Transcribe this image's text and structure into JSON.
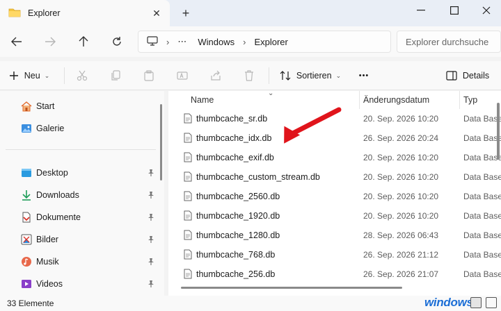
{
  "window": {
    "tab_title": "Explorer",
    "tab_icon": "folder-icon",
    "minimize_icon": "minimize-icon",
    "maximize_icon": "maximize-icon",
    "close_icon": "close-icon"
  },
  "address": {
    "breadcrumb": [
      "Windows",
      "Explorer"
    ],
    "search_placeholder": "Explorer durchsuchen"
  },
  "toolbar": {
    "new_label": "Neu",
    "sort_label": "Sortieren",
    "more_label": "•••",
    "details_label": "Details"
  },
  "sidebar": {
    "items": [
      {
        "label": "Start",
        "icon": "home-icon"
      },
      {
        "label": "Galerie",
        "icon": "gallery-icon"
      },
      {
        "label": "Desktop",
        "icon": "desktop-icon",
        "pinned": true
      },
      {
        "label": "Downloads",
        "icon": "download-icon",
        "pinned": true
      },
      {
        "label": "Dokumente",
        "icon": "documents-icon",
        "pinned": true
      },
      {
        "label": "Bilder",
        "icon": "pictures-icon",
        "pinned": true
      },
      {
        "label": "Musik",
        "icon": "music-icon",
        "pinned": true
      },
      {
        "label": "Videos",
        "icon": "videos-icon",
        "pinned": true
      }
    ]
  },
  "columns": {
    "name": "Name",
    "date": "Änderungsdatum",
    "type": "Typ"
  },
  "files": [
    {
      "name": "thumbcache_sr.db",
      "date": "20. Sep. 2026 10:20",
      "type": "Data Base File"
    },
    {
      "name": "thumbcache_idx.db",
      "date": "26. Sep. 2026 20:24",
      "type": "Data Base File"
    },
    {
      "name": "thumbcache_exif.db",
      "date": "20. Sep. 2026 10:20",
      "type": "Data Base File"
    },
    {
      "name": "thumbcache_custom_stream.db",
      "date": "20. Sep. 2026 10:20",
      "type": "Data Base File"
    },
    {
      "name": "thumbcache_2560.db",
      "date": "20. Sep. 2026 10:20",
      "type": "Data Base File"
    },
    {
      "name": "thumbcache_1920.db",
      "date": "20. Sep. 2026 10:20",
      "type": "Data Base File"
    },
    {
      "name": "thumbcache_1280.db",
      "date": "28. Sep. 2026 06:43",
      "type": "Data Base File"
    },
    {
      "name": "thumbcache_768.db",
      "date": "26. Sep. 2026 21:12",
      "type": "Data Base File"
    },
    {
      "name": "thumbcache_256.db",
      "date": "26. Sep. 2026 21:07",
      "type": "Data Base File"
    }
  ],
  "status": {
    "count": "33 Elemente"
  },
  "watermark": "windows",
  "colors": {
    "accent": "#1d6fd6",
    "arrow": "#e0141b"
  }
}
